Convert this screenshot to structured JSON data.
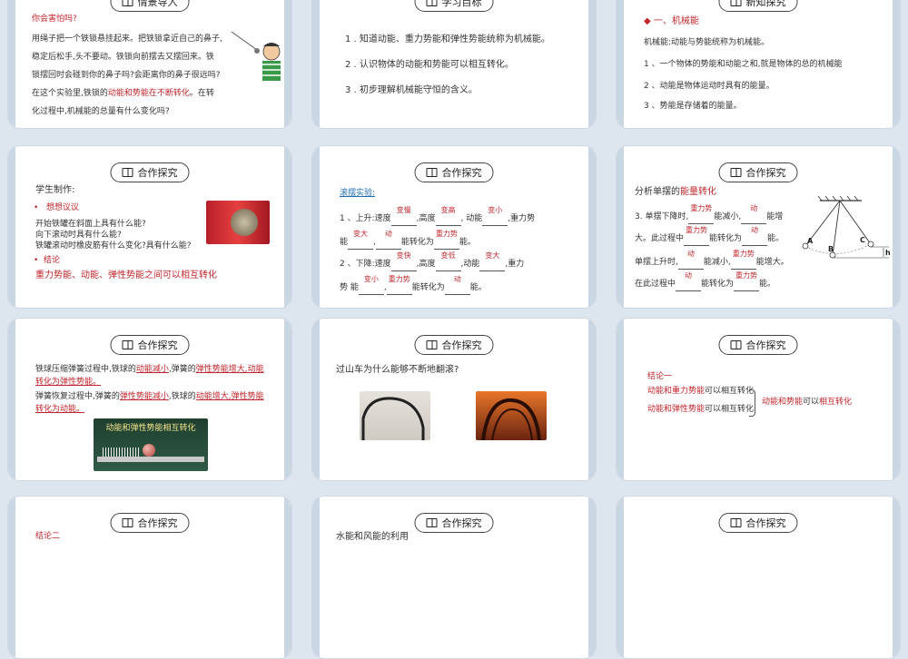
{
  "slides": [
    {
      "header": "情景导入"
    },
    {
      "header": "学习目标"
    },
    {
      "header": "新知探究"
    },
    {
      "header": "合作探究"
    },
    {
      "header": "合作探究"
    },
    {
      "header": "合作探究"
    },
    {
      "header": "合作探究"
    },
    {
      "header": "合作探究"
    },
    {
      "header": "合作探究"
    },
    {
      "header": "合作探究"
    },
    {
      "header": "合作探究"
    },
    {
      "header": "合作探究"
    }
  ],
  "s1": {
    "title": "你会害怕吗?",
    "lines": [
      "用绳子把一个铁锁悬挂起来。把铁锁拿近自己的鼻子,",
      "稳定后松手,头不要动。铁锁向前摆去又摆回来。铁",
      "锁摆回时会碰到你的鼻子吗?会距离你的鼻子很远吗?"
    ],
    "line4a": "在这个实验里,铁锁的",
    "line4b": "动能和势能在不断转化",
    "line4c": "。在转",
    "line5": "化过程中,机械能的总量有什么变化吗?"
  },
  "s2": {
    "items": [
      "1 . 知道动能、重力势能和弹性势能统称为机械能。",
      "2 . 认识物体的动能和势能可以相互转化。",
      "3 . 初步理解机械能守恒的含义。"
    ]
  },
  "s3": {
    "title": "◆ 一、机械能",
    "def": "机械能:动能与势能统称为机械能。",
    "items": [
      "1 、一个物体的势能和动能之和,就是物体的总的机械能",
      "2 、动能是物体运动时具有的能量。",
      "3 、势能是存储着的能量。"
    ]
  },
  "s4": {
    "title": "学生制作:",
    "q_head": "想想议议",
    "qs": [
      "开始铁罐在斜面上具有什么能?",
      "向下滚动时具有什么能?",
      "铁罐滚动时橡皮筋有什么变化?具有什么能?"
    ],
    "c_head": "结论",
    "conclusion": "重力势能、动能、弹性势能之间可以相互转化"
  },
  "s5": {
    "title": "滚摆实验:",
    "l1": "1 、上升:速度",
    "a1": "变慢",
    "l1b": ",高度",
    "a2": "变高",
    "l1c": ", 动能",
    "a3": "变小",
    "l1d": ",重力势",
    "l2": "能",
    "a4": "变大",
    "l2b": ",",
    "a5": "动",
    "l2c": "能转化为",
    "a6": "重力势",
    "l2d": "能。",
    "l3": "2 、下降:速度",
    "a7": "变快",
    "l3b": ",高度",
    "a8": "变低",
    "l3c": ",动能",
    "a9": "变大",
    "l3d": ",重力",
    "l4": "势 能",
    "a10": "变小",
    "l4b": ",",
    "a11": "重力势",
    "l4c": "能转化为",
    "a12": "动",
    "l4d": "能。"
  },
  "s6": {
    "title_a": "分析单摆的",
    "title_b": "能量转化",
    "l1": "3. 单摆下降时,",
    "a1": "重力势",
    "l1b": "能减小,",
    "a2": "动",
    "l1c": "能增",
    "l2": "大。此过程中",
    "a3": "重力势",
    "l2b": "能转化为",
    "a4": "动",
    "l2c": "能。",
    "l3": "单摆上升时,",
    "a5": "动",
    "l3b": "能减小,",
    "a6": "重力势",
    "l3c": "能增大。",
    "l4": "在此过程中",
    "a7": "动",
    "l4b": "能转化为",
    "a8": "重力势",
    "l4c": "能。",
    "labels": {
      "A": "A",
      "B": "B",
      "C": "C",
      "h": "h"
    }
  },
  "s7": {
    "p1a": "铁球压缩弹簧过程中,铁球的",
    "p1b": "动能减小",
    "p1c": ",弹簧的",
    "p1d": "弹性势能增大,动能",
    "p1e": "转化为弹性势能。",
    "p2a": "弹簧恢复过程中,弹簧的",
    "p2b": "弹性势能减小",
    "p2c": ",铁球的",
    "p2d": "动能增大,弹性势能",
    "p2e": "转化为动能。",
    "img_caption": "动能和弹性势能相互转化"
  },
  "s8": {
    "question": "过山车为什么能够不断地翻滚?"
  },
  "s9": {
    "head": "结论一",
    "r1a": "动能和",
    "r1b": "重力势能",
    "r1c": "可以相互转化",
    "r2a": "动能和",
    "r2b": "弹性势能",
    "r2c": "可以相互转化",
    "ra": "动能和",
    "rb": "势能",
    "rc": "可以",
    "rd": "相互转化"
  },
  "s10": {
    "head": "结论二"
  },
  "s11": {
    "title": "水能和风能的利用"
  }
}
